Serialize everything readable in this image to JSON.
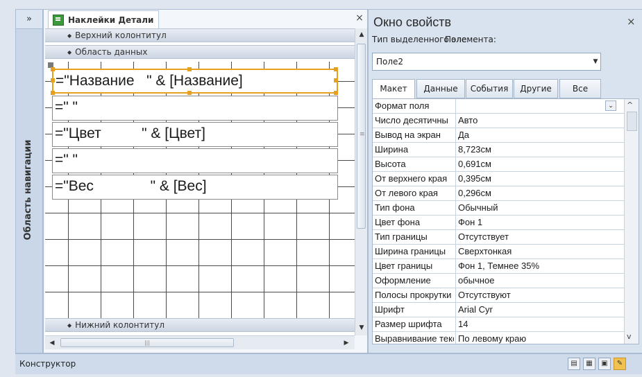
{
  "navigation_pane": {
    "toggle": "»",
    "title": "Область навигации"
  },
  "design_view": {
    "tab_title": "Наклейки Детали",
    "close": "×",
    "bands": {
      "page_header": "Верхний колонтитул",
      "detail": "Область данных",
      "page_footer": "Нижний колонтитул"
    },
    "fields": [
      "=\"Название   \" & [Название]",
      "=\" \"",
      "=\"Цвет          \" & [Цвет]",
      "=\" \"",
      "=\"Вес              \" & [Вес]"
    ],
    "scroll": {
      "up": "▲",
      "down": "▼",
      "left": "◀",
      "right": "▶",
      "grip": "≡",
      "h_grip": "|||"
    }
  },
  "property_sheet": {
    "title": "Окно свойств",
    "close": "×",
    "selection_type_label": "Тип выделенного элемента:",
    "selection_type_value": "Поле",
    "selected_control": "Поле2",
    "tabs": [
      "Макет",
      "Данные",
      "События",
      "Другие",
      "Все"
    ],
    "active_tab": "Макет",
    "properties": [
      {
        "name": "Формат поля",
        "value": ""
      },
      {
        "name": "Число десятичны",
        "value": "Авто"
      },
      {
        "name": "Вывод на экран",
        "value": "Да"
      },
      {
        "name": "Ширина",
        "value": "8,723см"
      },
      {
        "name": "Высота",
        "value": "0,691см"
      },
      {
        "name": "От верхнего края",
        "value": "0,395см"
      },
      {
        "name": "От левого края",
        "value": "0,296см"
      },
      {
        "name": "Тип фона",
        "value": "Обычный"
      },
      {
        "name": "Цвет фона",
        "value": "Фон 1"
      },
      {
        "name": "Тип границы",
        "value": "Отсутствует"
      },
      {
        "name": "Ширина границы",
        "value": "Сверхтонкая"
      },
      {
        "name": "Цвет границы",
        "value": "Фон 1, Темнее 35%"
      },
      {
        "name": "Оформление",
        "value": "обычное"
      },
      {
        "name": "Полосы прокрутки",
        "value": "Отсутствуют"
      },
      {
        "name": "Шрифт",
        "value": "Arial Cyr"
      },
      {
        "name": "Размер шрифта",
        "value": "14"
      },
      {
        "name": "Выравнивание текста",
        "value": "По левому краю"
      }
    ],
    "dropdown_glyph": "⌄",
    "scroll_up": "^",
    "scroll_down": "v"
  },
  "status_bar": {
    "text": "Конструктор",
    "view_buttons": [
      "▤",
      "▦",
      "▣",
      "✎"
    ]
  },
  "colors": {
    "selection_outline": "#e6a020",
    "panel_bg": "#d9e3ef",
    "nav_bg": "#c9d7e8"
  }
}
